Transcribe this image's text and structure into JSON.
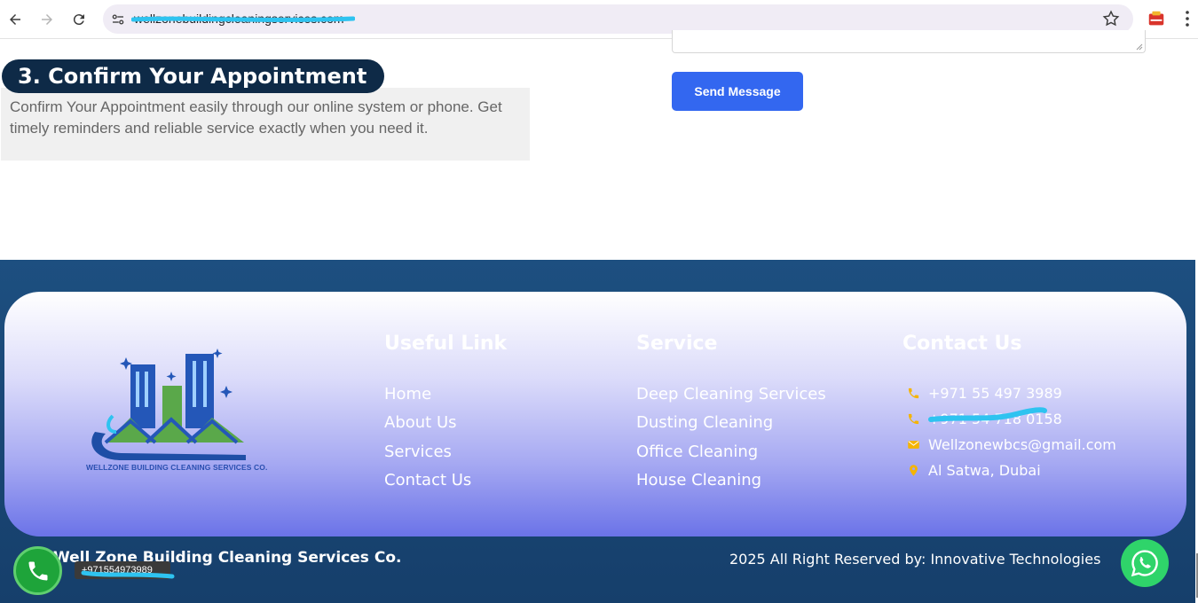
{
  "browser": {
    "url": "wellzonebuildingcleaningservices.com",
    "icons": [
      "back-icon",
      "forward-icon",
      "reload-icon",
      "site-settings-icon",
      "bookmark-star-icon",
      "extension-icon",
      "menu-kebab-icon"
    ]
  },
  "step": {
    "title": "3. Confirm Your Appointment",
    "body": "Confirm Your Appointment easily through our online system or phone. Get timely reminders and reliable service exactly when you need it."
  },
  "form": {
    "send_label": "Send Message"
  },
  "footer": {
    "logo_caption": "WELLZONE BUILDING CLEANING SERVICES CO.",
    "useful_links": {
      "heading": "Useful Link",
      "items": [
        "Home",
        "About Us",
        "Services",
        "Contact Us"
      ]
    },
    "service": {
      "heading": "Service",
      "items": [
        "Deep Cleaning Services",
        "Dusting Cleaning",
        "Office Cleaning",
        "House Cleaning"
      ]
    },
    "contact": {
      "heading": "Contact Us",
      "phone1": "+971 55 497 3989",
      "phone2": "+971 54 718 0158",
      "email": "Wellzonewbcs@gmail.com",
      "address": "Al Satwa, Dubai"
    },
    "company": "Well Zone Building Cleaning Services Co.",
    "copyright": "2025 All Right Reserved by: Innovative Technologies"
  },
  "floating": {
    "call_number": "+971554973989"
  },
  "colors": {
    "title_bg": "#0e2a47",
    "button": "#3367f0",
    "footer_bg": "#1a4877",
    "icon_accent": "#f5b400",
    "call": "#1ea43a",
    "whatsapp": "#2fd46a"
  }
}
